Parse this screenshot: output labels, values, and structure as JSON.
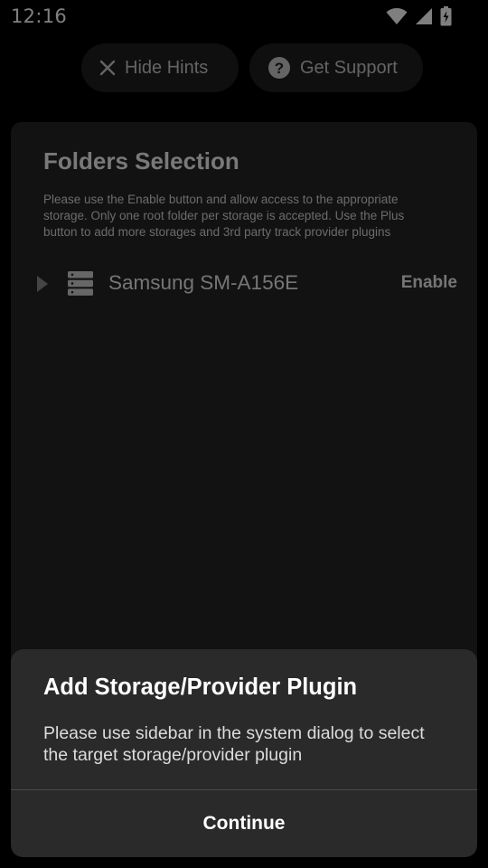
{
  "status_bar": {
    "time": "12:16",
    "icons": [
      "wifi-icon",
      "signal-icon",
      "battery-charging-icon"
    ]
  },
  "hints_bar": {
    "hide_hints_label": "Hide Hints",
    "hide_hints_icon": "close-icon",
    "get_support_label": "Get Support",
    "get_support_icon": "help-circle-icon"
  },
  "folders_card": {
    "title": "Folders Selection",
    "description": "Please use the Enable button and allow access to the appropriate storage. Only one root folder per storage is accepted. Use the Plus button to add more storages and 3rd party track provider plugins",
    "storages": [
      {
        "name": "Samsung SM-A156E",
        "action_label": "Enable",
        "icon": "storage-server-icon",
        "expand_icon": "triangle-right-icon"
      }
    ]
  },
  "dialog": {
    "title": "Add Storage/Provider Plugin",
    "body": "Please use sidebar in the system dialog to select the target storage/provider plugin",
    "button_label": "Continue"
  },
  "colors": {
    "background": "#000000",
    "card": "#242424",
    "dialog": "#2a2a2a",
    "text_primary": "#ffffff"
  }
}
